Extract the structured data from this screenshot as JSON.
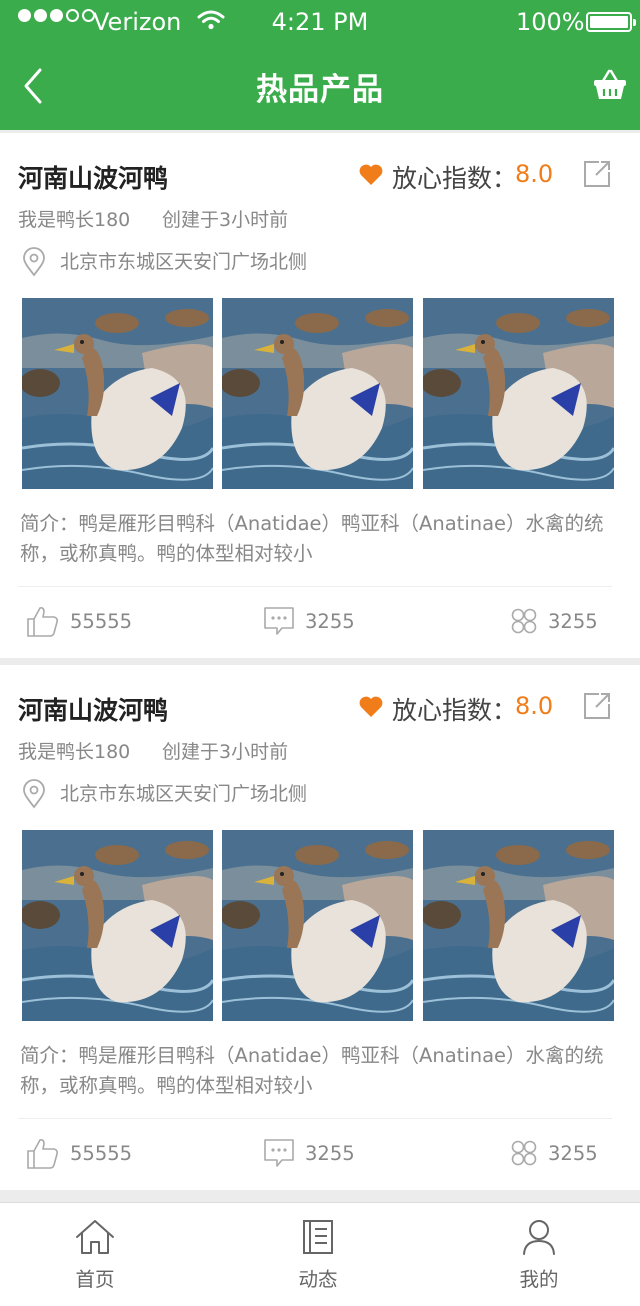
{
  "status_bar": {
    "carrier": "Verizon",
    "time": "4:21 PM",
    "battery": "100%",
    "signal_bars": 3,
    "signal_total": 5
  },
  "header": {
    "title": "热品产品",
    "back_icon": "chevron-left-icon",
    "cart_icon": "basket-icon"
  },
  "posts": [
    {
      "name": "河南山波河鸭",
      "trust_label": "放心指数：",
      "trust_value": "8.0",
      "author": "我是鸭长180",
      "created": "创建于3小时前",
      "address": "北京市东城区天安门广场北侧",
      "description": "简介：鸭是雁形目鸭科（Anatidae）鸭亚科（Anatinae）水禽的统称，或称真鸭。鸭的体型相对较小",
      "likes": "55555",
      "comments": "3255",
      "shares": "3255"
    },
    {
      "name": "河南山波河鸭",
      "trust_label": "放心指数：",
      "trust_value": "8.0",
      "author": "我是鸭长180",
      "created": "创建于3小时前",
      "address": "北京市东城区天安门广场北侧",
      "description": "简介：鸭是雁形目鸭科（Anatidae）鸭亚科（Anatinae）水禽的统称，或称真鸭。鸭的体型相对较小",
      "likes": "55555",
      "comments": "3255",
      "shares": "3255"
    }
  ],
  "tabs": [
    {
      "label": "首页",
      "icon": "home-icon"
    },
    {
      "label": "动态",
      "icon": "document-icon"
    },
    {
      "label": "我的",
      "icon": "user-icon"
    }
  ],
  "colors": {
    "brand_green": "#3aac4b",
    "accent_orange": "#f07d19",
    "muted_text": "#888888"
  }
}
